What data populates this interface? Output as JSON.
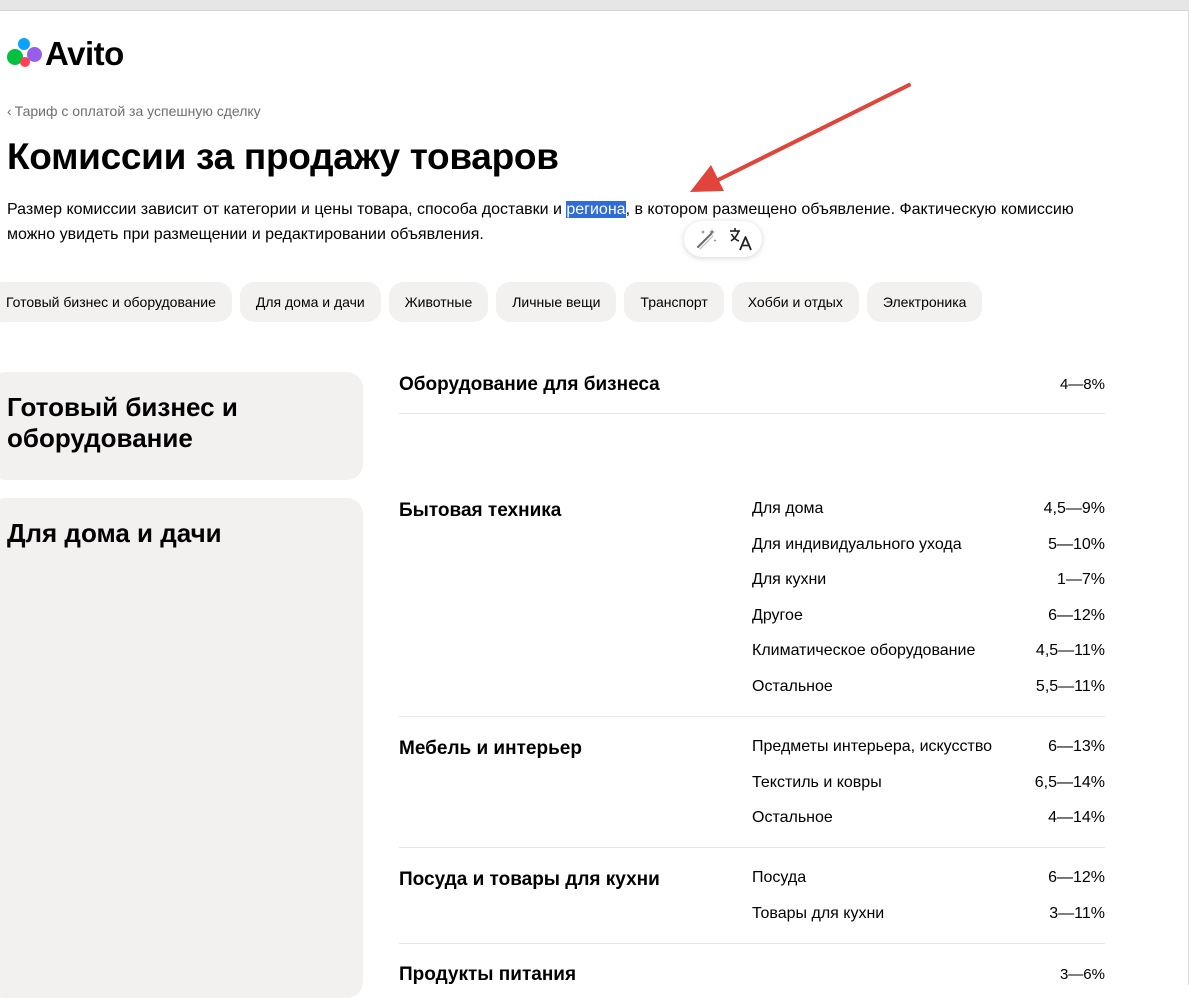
{
  "brand": {
    "name": "Avito"
  },
  "breadcrumb": {
    "label": "Тариф с оплатой за успешную сделку"
  },
  "page": {
    "title": "Комиссии за продажу товаров",
    "intro_before": "Размер комиссии зависит от категории и цены товара, способа доставки и ",
    "intro_highlight": "региона",
    "intro_after": ", в котором размещено объявление. Фактическую комиссию можно увидеть при размещении и редактировании объявления."
  },
  "selection_toolbar": {
    "icons": [
      "magic-wand-icon",
      "translate-icon"
    ],
    "highlight_color": "#2f6cd8"
  },
  "annotation": {
    "arrow_color": "#e0443a"
  },
  "chips": [
    "Готовый бизнес и оборудование",
    "Для дома и дачи",
    "Животные",
    "Личные вещи",
    "Транспорт",
    "Хобби и отдых",
    "Электроника"
  ],
  "categories": [
    {
      "title": "Готовый бизнес и оборудование",
      "sections": [
        {
          "name": "Оборудование для бизнеса",
          "range": "4—8%"
        }
      ]
    },
    {
      "title": "Для дома и дачи",
      "sections": [
        {
          "name": "Бытовая техника",
          "items": [
            {
              "name": "Для дома",
              "range": "4,5—9%"
            },
            {
              "name": "Для индивидуального ухода",
              "range": "5—10%"
            },
            {
              "name": "Для кухни",
              "range": "1—7%"
            },
            {
              "name": "Другое",
              "range": "6—12%"
            },
            {
              "name": "Климатическое оборудование",
              "range": "4,5—11%"
            },
            {
              "name": "Остальное",
              "range": "5,5—11%"
            }
          ]
        },
        {
          "name": "Мебель и интерьер",
          "items": [
            {
              "name": "Предметы интерьера, искусство",
              "range": "6—13%"
            },
            {
              "name": "Текстиль и ковры",
              "range": "6,5—14%"
            },
            {
              "name": "Остальное",
              "range": "4—14%"
            }
          ]
        },
        {
          "name": "Посуда и товары для кухни",
          "items": [
            {
              "name": "Посуда",
              "range": "6—12%"
            },
            {
              "name": "Товары для кухни",
              "range": "3—11%"
            }
          ]
        },
        {
          "name": "Продукты питания",
          "range": "3—6%"
        }
      ]
    }
  ]
}
